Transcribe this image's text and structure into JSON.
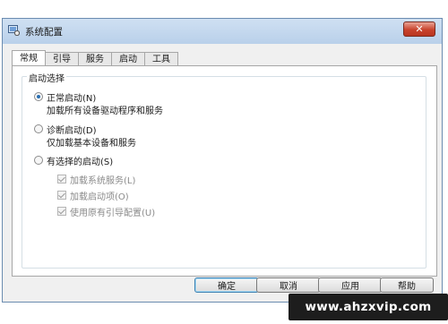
{
  "window": {
    "title": "系统配置",
    "close_symbol": "✕"
  },
  "tabs": [
    {
      "label": "常规",
      "active": true
    },
    {
      "label": "引导"
    },
    {
      "label": "服务"
    },
    {
      "label": "启动"
    },
    {
      "label": "工具"
    }
  ],
  "startup_group": {
    "title": "启动选择",
    "options": [
      {
        "label": "正常启动(N)",
        "description": "加载所有设备驱动程序和服务",
        "selected": true
      },
      {
        "label": "诊断启动(D)",
        "description": "仅加载基本设备和服务",
        "selected": false
      },
      {
        "label": "有选择的启动(S)",
        "description": "",
        "selected": false
      }
    ],
    "selective_items": [
      {
        "label": "加载系统服务(L)",
        "checked": true,
        "enabled": false
      },
      {
        "label": "加载启动项(O)",
        "checked": true,
        "enabled": false
      },
      {
        "label": "使用原有引导配置(U)",
        "checked": true,
        "enabled": false
      }
    ]
  },
  "buttons": {
    "ok": "确定",
    "cancel": "取消",
    "apply": "应用",
    "help": "帮助"
  },
  "watermark": "www.ahzxvip.com",
  "colors": {
    "title_gradient_top": "#cfe0f2",
    "close_red": "#c8432d",
    "radio_dot": "#2a6fb0"
  },
  "icons": {
    "app": "system-config-icon",
    "close": "close-icon"
  }
}
